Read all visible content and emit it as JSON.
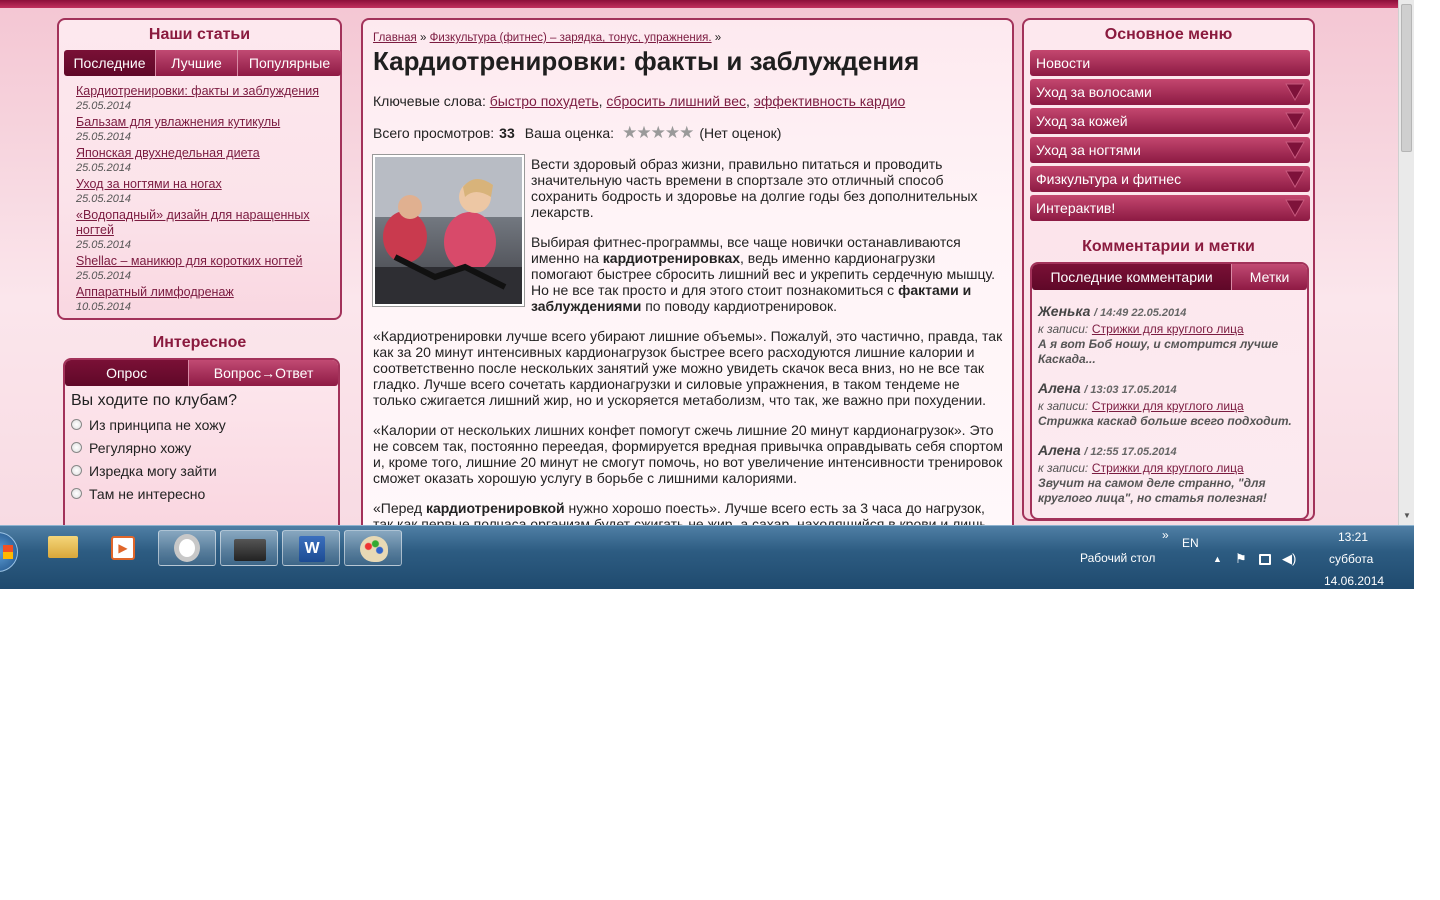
{
  "left": {
    "title": "Наши статьи",
    "tabs": [
      "Последние",
      "Лучшие",
      "Популярные"
    ],
    "articles": [
      {
        "title": "Кардиотренировки: факты и заблуждения",
        "date": "25.05.2014"
      },
      {
        "title": "Бальзам для увлажнения кутикулы",
        "date": "25.05.2014"
      },
      {
        "title": "Японская двухнедельная диета",
        "date": "25.05.2014"
      },
      {
        "title": "Уход за ногтями на ногах",
        "date": "25.05.2014"
      },
      {
        "title": "«Водопадный» дизайн для наращенных ногтей",
        "date": "25.05.2014"
      },
      {
        "title": "Shellac – маникюр для коротких ногтей",
        "date": "25.05.2014"
      },
      {
        "title": "Аппаратный лимфодренаж",
        "date": "10.05.2014"
      }
    ],
    "interest_title": "Интересное",
    "poll_tabs": [
      "Опрос",
      "Вопрос→Ответ"
    ],
    "poll_question": "Вы ходите по клубам?",
    "poll_options": [
      "Из принципа не хожу",
      "Регулярно хожу",
      "Изредка могу зайти",
      "Там не интересно"
    ]
  },
  "center": {
    "breadcrumb": {
      "home": "Главная",
      "sep": "»",
      "category": "Физкультура (фитнес) – зарядка, тонус, упражнения."
    },
    "title": "Кардиотренировки: факты и заблуждения",
    "keywords_label": "Ключевые слова:",
    "keywords": [
      "быстро похудеть",
      "сбросить лишний вес",
      "эффективность кардио"
    ],
    "views_label": "Всего просмотров:",
    "views": "33",
    "rating_label": "Ваша оценка:",
    "rating_stars": 5,
    "rating_text": "(Нет оценок)",
    "p1": "Вести здоровый образ жизни, правильно питаться и проводить значительную часть времени в спортзале это отличный способ сохранить бодрость и здоровье на долгие годы без дополнительных лекарств.",
    "p2_a": "Выбирая фитнес-программы, все чаще новички останавливаются именно на ",
    "p2_b": "кардиотренировках",
    "p2_c": ", ведь именно кардионагрузки помогают быстрее сбросить лишний вес и укрепить сердечную мышцу. Но не все так просто и для этого стоит познакомиться с ",
    "p2_d": "фактами и заблуждениями",
    "p2_e": " по поводу кардиотренировок.",
    "p3": "«Кардиотренировки лучше всего убирают лишние объемы». Пожалуй, это частично, правда, так как за 20 минут интенсивных кардионагрузок быстрее всего расходуются лишние калории и соответственно после нескольких занятий уже можно увидеть скачок веса вниз, но не все так гладко. Лучше всего сочетать кардионагрузки и силовые упражнения, в таком тендеме не только сжигается лишний жир, но и ускоряется метаболизм, что так, же важно при похудении.",
    "p4": "«Калории от нескольких лишних конфет помогут сжечь лишние 20 минут кардионагрузок». Это не совсем так, постоянно переедая, формируется вредная привычка оправдывать себя спортом и, кроме того, лишние 20 минут не смогут помочь, но вот увеличение интенсивности тренировок сможет оказать хорошую услугу в борьбе с лишними калориями.",
    "p5_a": "«Перед ",
    "p5_b": "кардиотренировкой",
    "p5_c": " нужно хорошо поесть». Лучше всего есть за 3 часа до нагрузок, так как первые полчаса организм будет сжигать не жир, а сахар, находящийся в крови и лишь"
  },
  "right": {
    "menu_title": "Основное меню",
    "menu": [
      "Новости",
      "Уход за волосами",
      "Уход за кожей",
      "Уход за ногтями",
      "Физкультура и фитнес",
      "Интерактив!"
    ],
    "comments_title": "Комментарии и метки",
    "comment_tabs": [
      "Последние комментарии",
      "Метки"
    ],
    "entry_label": "к записи:",
    "comments": [
      {
        "author": "Женька",
        "time": "/ 14:49 22.05.2014",
        "post": "Стрижки для круглого лица",
        "text": "А я вот Боб ношу, и смотрится лучше Каскада..."
      },
      {
        "author": "Алена",
        "time": "/ 13:03 17.05.2014",
        "post": "Стрижки для круглого лица",
        "text": "Стрижка каскад больше всего подходит."
      },
      {
        "author": "Алена",
        "time": "/ 12:55 17.05.2014",
        "post": "Стрижки для круглого лица",
        "text": "Звучит на самом деле странно, \"для круглого лица\", но статья полезная!"
      }
    ]
  },
  "taskbar": {
    "desktop_label": "Рабочий стол",
    "lang": "EN",
    "time": "13:21",
    "day": "суббота",
    "date": "14.06.2014",
    "apps": [
      "explorer-icon",
      "media-player-icon",
      "opera-icon",
      "video-app-icon",
      "word-icon",
      "paint-icon"
    ]
  }
}
